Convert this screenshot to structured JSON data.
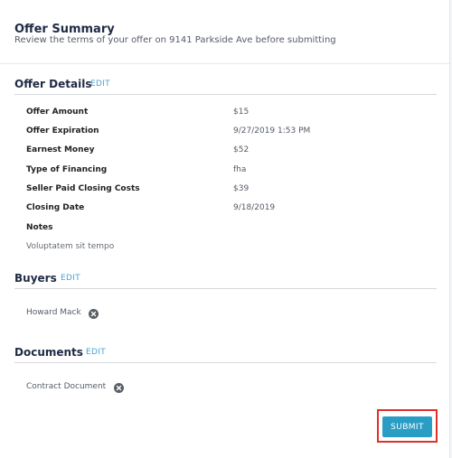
{
  "header": {
    "title": "Offer Summary",
    "subtitle": "Review the terms of your offer on 9141 Parkside Ave before submitting"
  },
  "offer_details": {
    "title": "Offer Details",
    "edit_label": "EDIT",
    "rows": [
      {
        "label": "Offer Amount",
        "value": "$15"
      },
      {
        "label": "Offer Expiration",
        "value": "9/27/2019 1:53 PM"
      },
      {
        "label": "Earnest Money",
        "value": "$52"
      },
      {
        "label": "Type of Financing",
        "value": "fha"
      },
      {
        "label": "Seller Paid Closing Costs",
        "value": "$39"
      },
      {
        "label": "Closing Date",
        "value": "9/18/2019"
      }
    ],
    "notes_label": "Notes",
    "notes_value": "Voluptatem sit tempo"
  },
  "buyers": {
    "title": "Buyers",
    "edit_label": "EDIT",
    "items": [
      {
        "name": "Howard Mack",
        "icon": "remove-icon"
      }
    ]
  },
  "documents": {
    "title": "Documents",
    "edit_label": "EDIT",
    "items": [
      {
        "name": "Contract Document",
        "icon": "remove-icon"
      }
    ]
  },
  "actions": {
    "submit_label": "SUBMIT"
  },
  "colors": {
    "accent": "#2a9dc5",
    "link": "#4aa3d0",
    "highlight": "#e0302c",
    "heading": "#1f2a44"
  }
}
